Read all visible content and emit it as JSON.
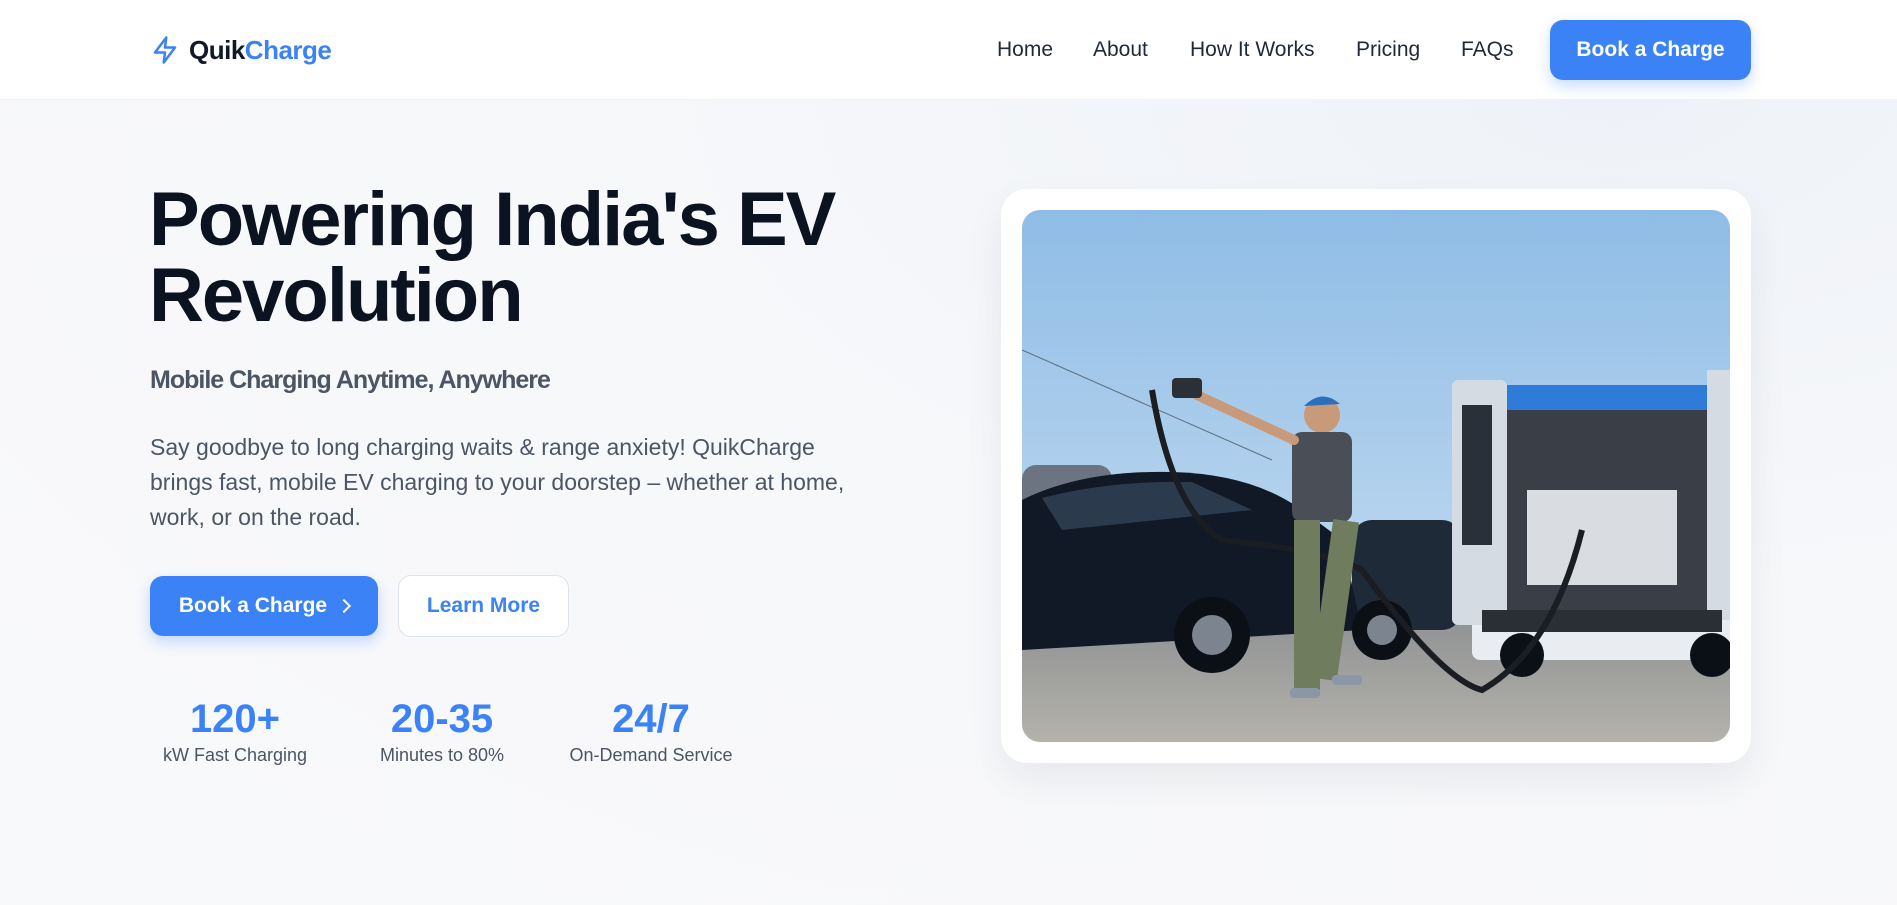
{
  "brand": {
    "name_part1": "Quik",
    "name_part2": "Charge",
    "accent": "#3b82f6",
    "icon": "lightning-bolt-icon"
  },
  "nav": {
    "items": [
      "Home",
      "About",
      "How It Works",
      "Pricing",
      "FAQs"
    ],
    "cta": "Book a Charge"
  },
  "hero": {
    "title": "Powering India's EV Revolution",
    "subtitle": "Mobile Charging Anytime, Anywhere",
    "description": "Say goodbye to long charging waits & range anxiety! QuikCharge brings fast, mobile EV charging to your doorstep – whether at home, work, or on the road.",
    "primary_button": "Book a Charge",
    "secondary_button": "Learn More"
  },
  "stats": [
    {
      "value": "120+",
      "label": "kW Fast Charging"
    },
    {
      "value": "20-35",
      "label": "Minutes to 80%"
    },
    {
      "value": "24/7",
      "label": "On-Demand Service"
    }
  ]
}
